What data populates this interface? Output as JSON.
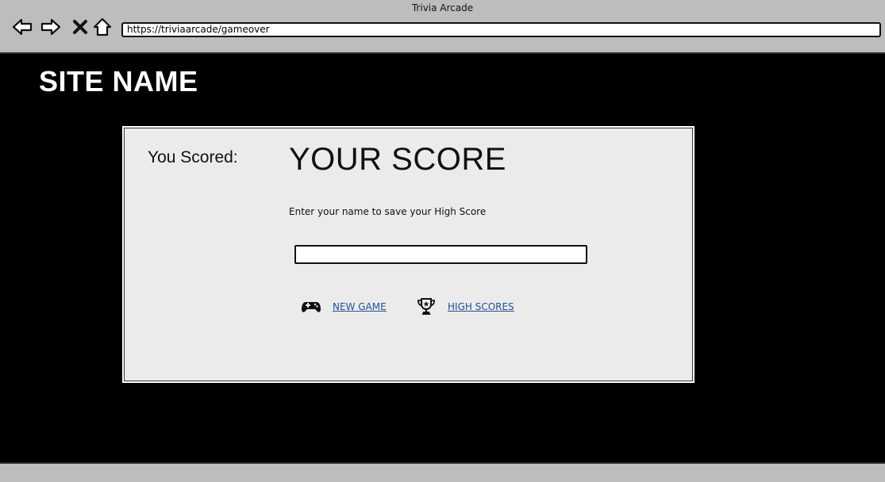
{
  "window": {
    "title": "Trivia Arcade",
    "url": "https://triviaarcade/gameover"
  },
  "nav_icons": [
    "back-icon",
    "forward-icon",
    "close-icon",
    "home-icon"
  ],
  "site": {
    "name": "SITE NAME"
  },
  "game_over": {
    "score_label": "You Scored:",
    "score_value": "YOUR SCORE",
    "prompt": "Enter your name to save your High Score",
    "name_input": {
      "value": "",
      "placeholder": ""
    },
    "actions": [
      {
        "label": "NEW GAME",
        "icon": "gamepad-icon"
      },
      {
        "label": "HIGH SCORES",
        "icon": "trophy-icon"
      }
    ]
  },
  "colors": {
    "background": "#000000",
    "chrome": "#bdbdbd",
    "panel": "#ebebeb",
    "link": "#1f4f95"
  }
}
